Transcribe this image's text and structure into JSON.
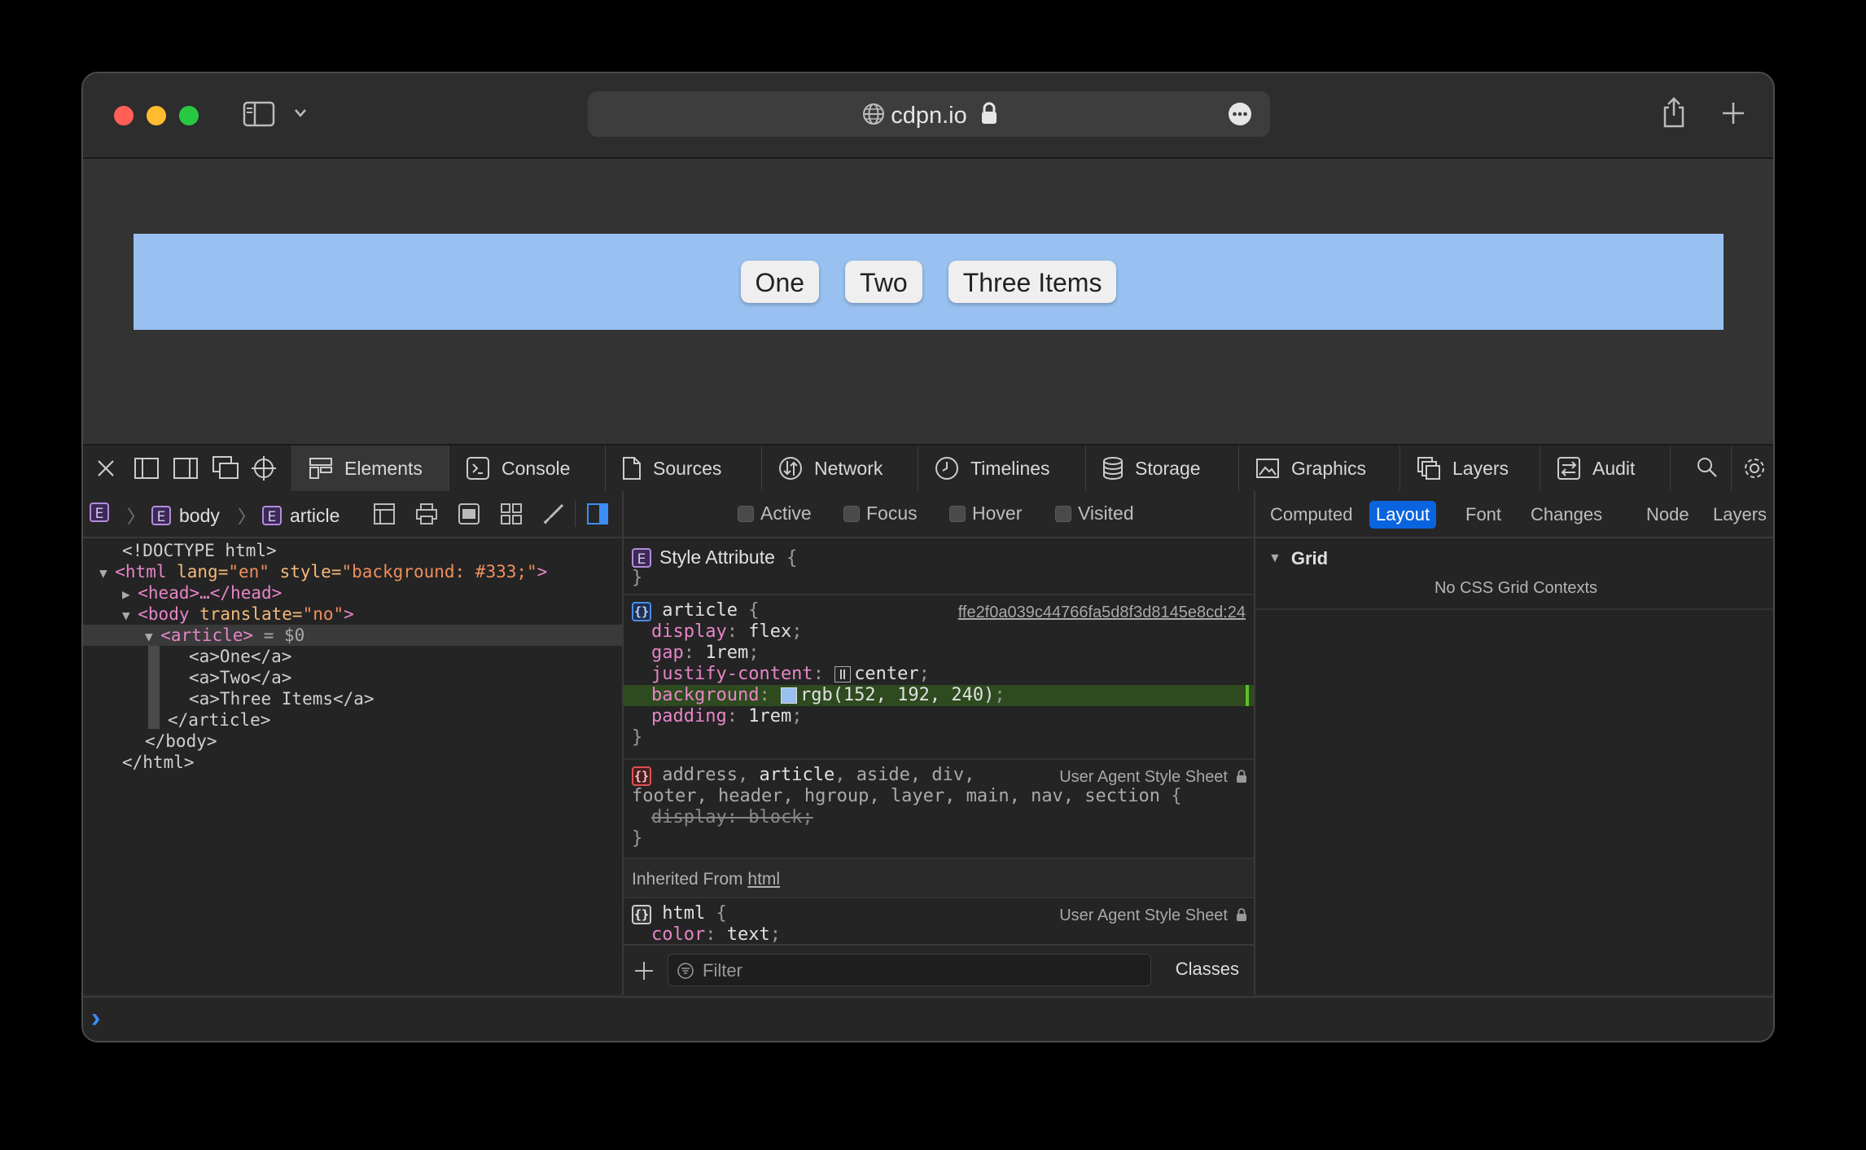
{
  "browser": {
    "url": "cdpn.io",
    "tabs_button_icon": "sidebar-icon",
    "share_icon": "share-icon",
    "new_tab_icon": "plus-icon"
  },
  "page": {
    "links": [
      "One",
      "Two",
      "Three Items"
    ],
    "article_background": "#98c0f0"
  },
  "devtools": {
    "tabs": [
      "Elements",
      "Console",
      "Sources",
      "Network",
      "Timelines",
      "Storage",
      "Graphics",
      "Layers",
      "Audit"
    ],
    "breadcrumbs": {
      "root_badge": "E",
      "body": "body",
      "article": "article"
    },
    "dom": {
      "doctype": "<!DOCTYPE html>",
      "html_open_tag": "<html",
      "html_lang_attr": " lang=",
      "html_lang_val": "\"en\"",
      "html_style_attr": " style=",
      "html_style_val": "\"background: #333;\"",
      "html_open_close": ">",
      "head": "<head>…</head>",
      "body_open_tag": "<body",
      "body_translate_attr": " translate=",
      "body_translate_val": "\"no\"",
      "body_open_close": ">",
      "article_open": "<article>",
      "article_ref": " = $0",
      "link_one": "<a>One</a>",
      "link_two": "<a>Two</a>",
      "link_three": "<a>Three Items</a>",
      "article_close": "</article>",
      "body_close": "</body>",
      "html_close": "</html>"
    },
    "pseudo_classes": [
      "Active",
      "Focus",
      "Hover",
      "Visited"
    ],
    "styles": {
      "style_attribute_label": "Style Attribute",
      "article_selector": "article",
      "article_source": "ffe2f0a039c44766fa5d8f3d8145e8cd:24",
      "declarations": [
        {
          "prop": "display",
          "value": "flex"
        },
        {
          "prop": "gap",
          "value": "1rem"
        },
        {
          "prop": "justify-content",
          "value": "center"
        },
        {
          "prop": "background",
          "value": "rgb(152, 192, 240)"
        },
        {
          "prop": "padding",
          "value": "1rem"
        }
      ],
      "ua_selector_line1_a": "address",
      "ua_selector_line1_b": "article",
      "ua_selector_line1_c": "aside, div,",
      "ua_selector_line2": "footer, header, hgroup, layer, main, nav, section",
      "ua_source": "User Agent Style Sheet",
      "ua_declaration": "display: block;",
      "inherited_label": "Inherited From ",
      "inherited_from": "html",
      "html_selector": "html",
      "html_source": "User Agent Style Sheet",
      "html_declaration_prop": "color",
      "html_declaration_value": "text"
    },
    "filter_placeholder": "Filter",
    "classes_label": "Classes",
    "side_tabs": [
      "Computed",
      "Layout",
      "Font",
      "Changes",
      "Node",
      "Layers"
    ],
    "active_side_tab": "Layout",
    "grid_section": "Grid",
    "grid_empty": "No CSS Grid Contexts",
    "console_prompt": "›"
  },
  "colors": {
    "accent": "#0a64e0",
    "close_light": "#ff5f57",
    "minimize_light": "#febc2e",
    "zoom_light": "#28c840"
  }
}
